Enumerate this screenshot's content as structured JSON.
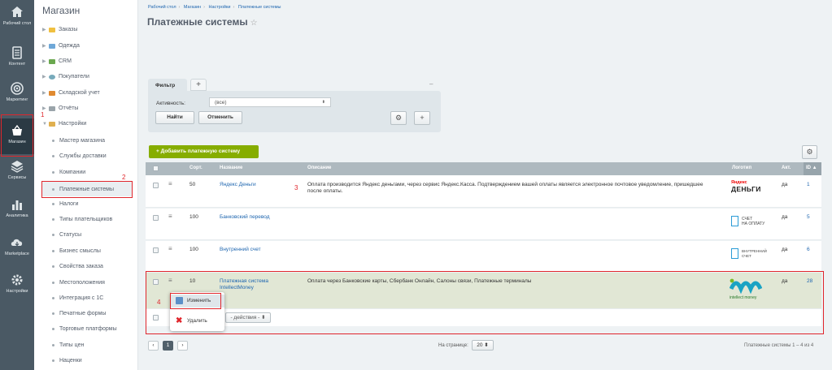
{
  "iconbar": {
    "items": [
      {
        "label": "Рабочий стол",
        "icon": "home-icon"
      },
      {
        "label": "Контент",
        "icon": "document-icon"
      },
      {
        "label": "Маркетинг",
        "icon": "target-icon"
      },
      {
        "label": "Магазин",
        "icon": "shop-basket-icon"
      },
      {
        "label": "Сервисы",
        "icon": "layers-icon"
      },
      {
        "label": "Аналитика",
        "icon": "bar-chart-icon"
      },
      {
        "label": "Marketplace",
        "icon": "cloud-download-icon"
      },
      {
        "label": "Настройки",
        "icon": "gear-icon"
      }
    ]
  },
  "menu": {
    "title": "Магазин",
    "items": [
      {
        "label": "Заказы"
      },
      {
        "label": "Одежда"
      },
      {
        "label": "CRM"
      },
      {
        "label": "Покупатели"
      },
      {
        "label": "Складской учет"
      },
      {
        "label": "Отчёты"
      },
      {
        "label": "Настройки"
      }
    ],
    "subitems": [
      {
        "label": "Мастер магазина"
      },
      {
        "label": "Службы доставки"
      },
      {
        "label": "Компании"
      },
      {
        "label": "Платежные системы"
      },
      {
        "label": "Налоги"
      },
      {
        "label": "Типы плательщиков"
      },
      {
        "label": "Статусы"
      },
      {
        "label": "Бизнес смыслы"
      },
      {
        "label": "Свойства заказа"
      },
      {
        "label": "Местоположения"
      },
      {
        "label": "Интеграция с 1С"
      },
      {
        "label": "Печатные формы"
      },
      {
        "label": "Торговые платформы"
      },
      {
        "label": "Типы цен"
      },
      {
        "label": "Наценки"
      }
    ]
  },
  "annotations": {
    "n1": "1",
    "n2": "2",
    "n3": "3",
    "n4": "4"
  },
  "breadcrumbs": [
    "Рабочий стол",
    "Магазин",
    "Настройки",
    "Платежные системы"
  ],
  "page_title": "Платежные системы",
  "filter": {
    "tab": "Фильтр",
    "plus": "+",
    "minimize": "–",
    "field_label": "Активность:",
    "field_value": "(все)",
    "find": "Найти",
    "cancel": "Отменить"
  },
  "add_button": "Добавить платежную систему",
  "table": {
    "headers": {
      "sort": "Сорт.",
      "name": "Название",
      "desc": "Описание",
      "logo": "Логотип",
      "active": "Акт.",
      "id": "ID"
    },
    "rows": [
      {
        "sort": "50",
        "name": "Яндекс Деньги",
        "desc": "Оплата производится Яндекс деньгами, через сервис Яндекс.Касса. Подтверждением вашей оплаты является электронное почтовое уведомление, пришедшее после оплаты.",
        "logo_top": "Яндекс",
        "logo_bottom": "ДЕНЬГИ",
        "active": "да",
        "id": "1"
      },
      {
        "sort": "100",
        "name": "Банковский перевод",
        "desc": "",
        "logo_top": "СЧЕТ",
        "logo_bottom": "НА ОПЛАТУ",
        "active": "да",
        "id": "5"
      },
      {
        "sort": "100",
        "name": "Внутренний счет",
        "desc": "",
        "logo_top": "ВНУТРЕННИЙ",
        "logo_bottom": "СЧЕТ",
        "active": "да",
        "id": "6"
      },
      {
        "sort": "10",
        "name": "Платежная система IntellectMoney",
        "desc": "Оплата через Банковские карты, Сбербанк Онлайн, Салоны связи, Платежные терминалы",
        "logo_top": "IM",
        "logo_bottom": "intellect money",
        "active": "да",
        "id": "28"
      }
    ],
    "actions_select": "- действия -"
  },
  "context_menu": {
    "edit": "Изменить",
    "delete": "Удалить"
  },
  "pager": {
    "prev": "‹",
    "page": "1",
    "next": "›",
    "per_page_label": "На странице:",
    "per_page": "20",
    "summary": "Платежные системы 1 – 4 из 4"
  },
  "colors": {
    "accent_green": "#86ad00",
    "annotation_red": "#e0262c",
    "sidebar": "#4a5964"
  }
}
